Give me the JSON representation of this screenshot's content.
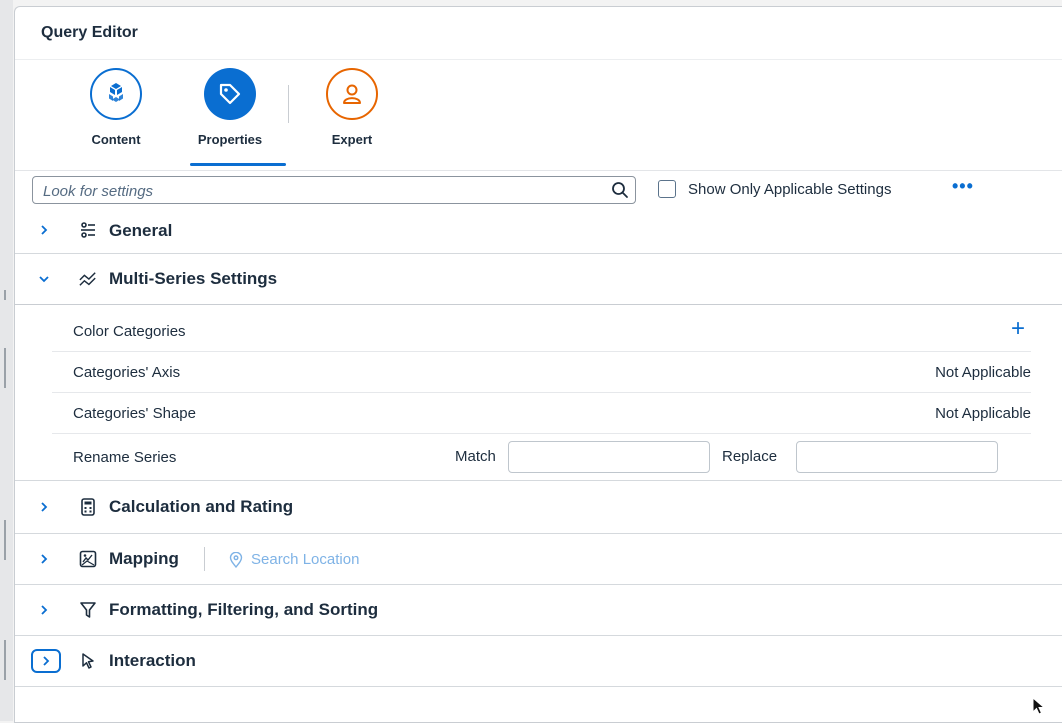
{
  "panel": {
    "title": "Query Editor"
  },
  "tabs": [
    {
      "label": "Content",
      "icon": "cube-icon"
    },
    {
      "label": "Properties",
      "icon": "tag-icon",
      "selected": true
    },
    {
      "label": "Expert",
      "icon": "person-icon"
    }
  ],
  "toolbar": {
    "search_placeholder": "Look for settings",
    "checkbox_label": "Show Only Applicable Settings",
    "more_label": "•••"
  },
  "sections": {
    "general": {
      "title": "General",
      "expanded": false
    },
    "multi_series": {
      "title": "Multi-Series Settings",
      "expanded": true
    },
    "calculation": {
      "title": "Calculation and Rating",
      "expanded": false
    },
    "mapping": {
      "title": "Mapping",
      "expanded": false,
      "search_location": "Search Location"
    },
    "formatting": {
      "title": "Formatting, Filtering, and Sorting",
      "expanded": false
    },
    "interaction": {
      "title": "Interaction",
      "expanded": false
    }
  },
  "multi_series_rows": {
    "color_categories": {
      "label": "Color Categories",
      "action": "+"
    },
    "categories_axis": {
      "label": "Categories' Axis",
      "value": "Not Applicable"
    },
    "categories_shape": {
      "label": "Categories' Shape",
      "value": "Not Applicable"
    },
    "rename_series": {
      "label": "Rename Series",
      "match_label": "Match",
      "match_value": "",
      "replace_label": "Replace",
      "replace_value": ""
    }
  },
  "colors": {
    "accent": "#0a6ed1",
    "expert": "#e76500",
    "text": "#1d2d3e"
  }
}
